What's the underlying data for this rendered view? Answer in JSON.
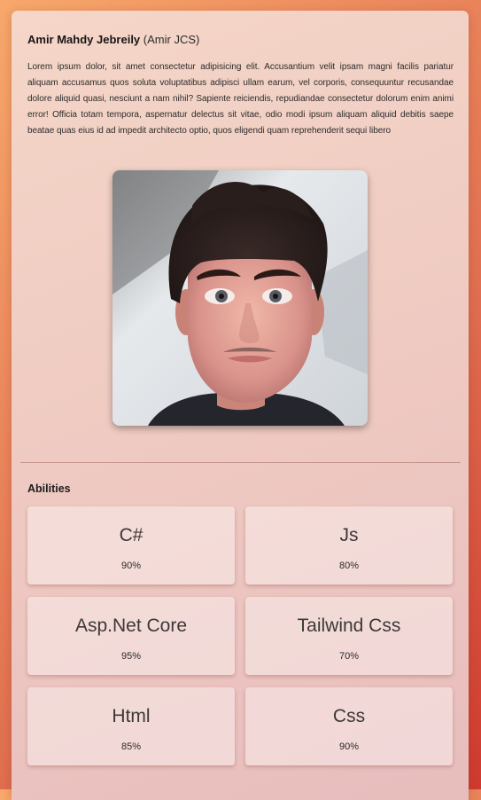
{
  "profile": {
    "name": "Amir Mahdy Jebreily",
    "alias": "(Amir JCS)",
    "bio": "Lorem ipsum dolor, sit amet consectetur adipisicing elit. Accusantium velit ipsam magni facilis pariatur aliquam accusamus quos soluta voluptatibus adipisci ullam earum, vel corporis, consequuntur recusandae dolore aliquid quasi, nesciunt a nam nihil? Sapiente reiciendis, repudiandae consectetur dolorum enim animi error! Officia totam tempora, aspernatur delectus sit vitae, odio modi ipsum aliquam aliquid debitis saepe beatae quas eius id ad impedit architecto optio, quos eligendi quam reprehenderit sequi libero",
    "avatar_icon": "profile-photo"
  },
  "abilities": {
    "title": "Abilities",
    "items": [
      {
        "name": "C#",
        "level": "90%"
      },
      {
        "name": "Js",
        "level": "80%"
      },
      {
        "name": "Asp.Net Core",
        "level": "95%"
      },
      {
        "name": "Tailwind Css",
        "level": "70%"
      },
      {
        "name": "Html",
        "level": "85%"
      },
      {
        "name": "Css",
        "level": "90%"
      }
    ]
  },
  "colors": {
    "background_start": "#f7a86a",
    "background_end": "#cf3a2e",
    "card": "#f2d2c6"
  }
}
